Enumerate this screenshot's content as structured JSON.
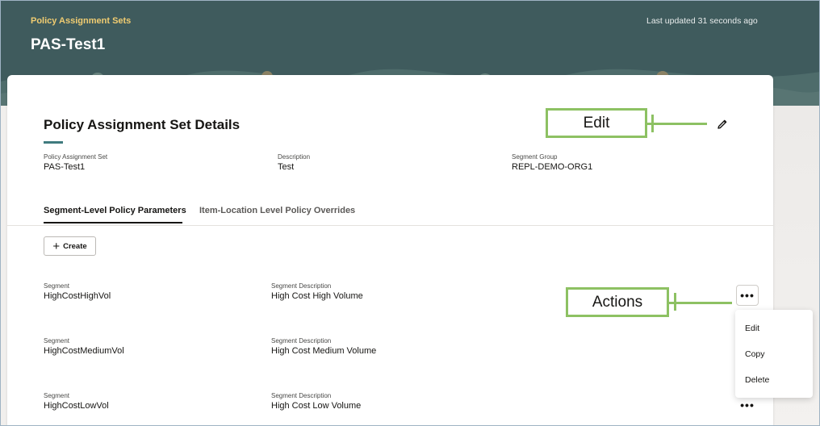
{
  "header": {
    "breadcrumb": "Policy Assignment Sets",
    "title": "PAS-Test1",
    "last_updated": "Last updated 31 seconds ago"
  },
  "details": {
    "title": "Policy Assignment Set Details",
    "fields": [
      {
        "label": "Policy Assignment Set",
        "value": "PAS-Test1"
      },
      {
        "label": "Description",
        "value": "Test"
      },
      {
        "label": "Segment Group",
        "value": "REPL-DEMO-ORG1"
      }
    ]
  },
  "tabs": [
    {
      "label": "Segment-Level Policy Parameters",
      "active": true
    },
    {
      "label": "Item-Location Level Policy Overrides",
      "active": false
    }
  ],
  "create_button": {
    "label": "Create"
  },
  "segments": [
    {
      "segment_label": "Segment",
      "segment": "HighCostHighVol",
      "desc_label": "Segment Description",
      "description": "High Cost High Volume"
    },
    {
      "segment_label": "Segment",
      "segment": "HighCostMediumVol",
      "desc_label": "Segment Description",
      "description": "High Cost Medium Volume"
    },
    {
      "segment_label": "Segment",
      "segment": "HighCostLowVol",
      "desc_label": "Segment Description",
      "description": "High Cost Low Volume"
    }
  ],
  "actions_menu": {
    "trigger": "•••",
    "items": [
      "Edit",
      "Copy",
      "Delete"
    ]
  },
  "annotations": {
    "edit_callout": "Edit",
    "actions_callout": "Actions",
    "callout_color": "#8dc163"
  },
  "colors": {
    "hero": "#3f5b5d",
    "breadcrumb": "#f0cc71",
    "accent": "#3f7b7e"
  }
}
